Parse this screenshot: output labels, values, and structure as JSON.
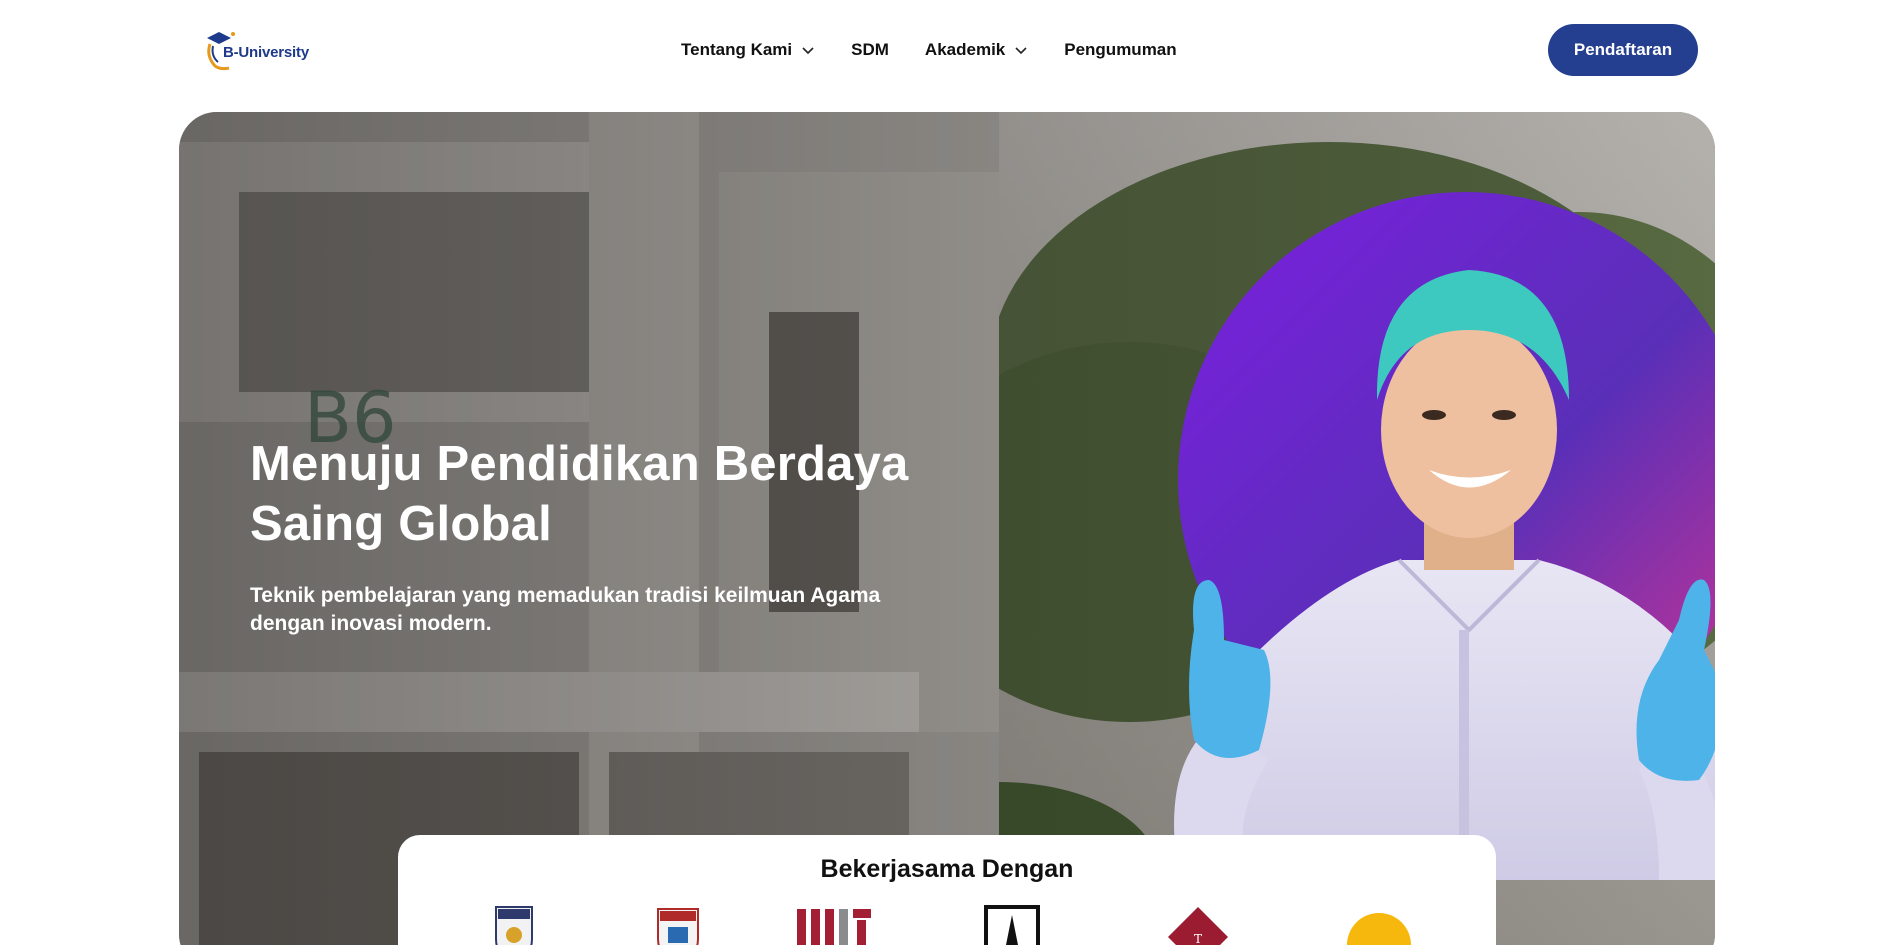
{
  "header": {
    "logo_text": "B-University",
    "nav": [
      {
        "label": "Tentang Kami",
        "has_dropdown": true
      },
      {
        "label": "SDM",
        "has_dropdown": false
      },
      {
        "label": "Akademik",
        "has_dropdown": true
      },
      {
        "label": "Pengumuman",
        "has_dropdown": false
      }
    ],
    "cta_label": "Pendaftaran"
  },
  "hero": {
    "title": "Menuju Pendidikan Berdaya Saing Global",
    "subtitle": "Teknik pembelajaran yang memadukan tradisi keilmuan Agama dengan inovasi modern."
  },
  "partners": {
    "title": "Bekerjasama Dengan",
    "logos": [
      "crest-logo-1",
      "crest-logo-2",
      "mit-logo",
      "tower-logo",
      "diamond-logo",
      "sun-logo"
    ]
  },
  "colors": {
    "brand": "#243f8f",
    "circle_start": "#7b1fe0",
    "circle_end": "#d5358f",
    "glove": "#4db3e8",
    "cap": "#3ec9c0"
  }
}
